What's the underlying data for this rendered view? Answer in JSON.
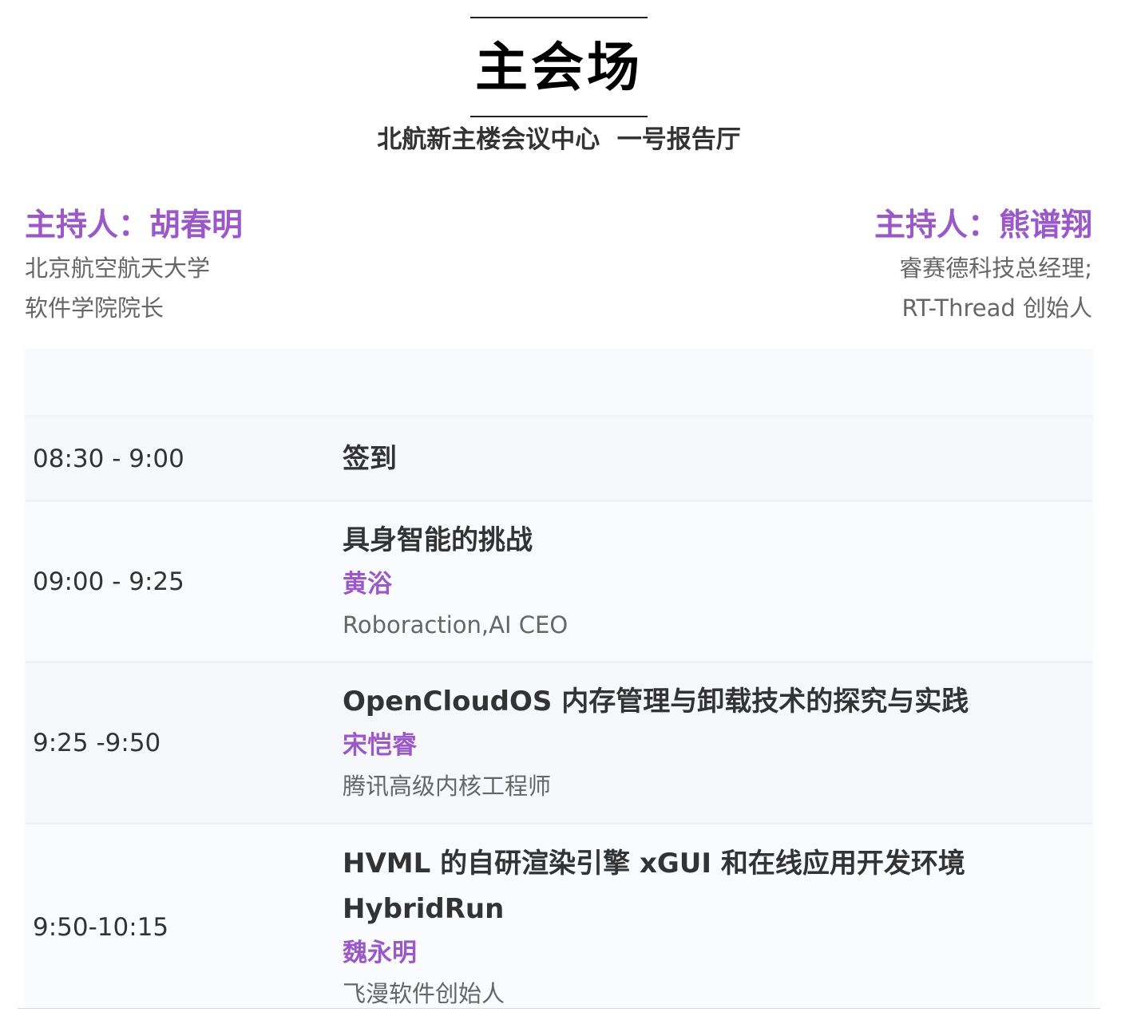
{
  "header": {
    "title": "主会场",
    "venue": "北航新主楼会议中心  一号报告厅"
  },
  "hosts": {
    "left": {
      "name": "主持人：胡春明",
      "lines": [
        "北京航空航天大学",
        "软件学院院长"
      ]
    },
    "right": {
      "name": "主持人：熊谱翔",
      "lines": [
        "睿赛德科技总经理;",
        "RT-Thread 创始人"
      ]
    }
  },
  "schedule": [
    {
      "time": "08:30 - 9:00",
      "title": "签到"
    },
    {
      "time": "09:00 - 9:25",
      "title": "具身智能的挑战",
      "speaker": "黄浴",
      "affiliation": "Roboraction,AI CEO"
    },
    {
      "time": "9:25 -9:50",
      "title": "OpenCloudOS 内存管理与卸载技术的探究与实践",
      "speaker": "宋恺睿",
      "affiliation": "腾讯高级内核工程师"
    },
    {
      "time": "9:50-10:15",
      "title": "HVML 的自研渲染引擎 xGUI 和在线应用开发环境 HybridRun",
      "speaker": "魏永明",
      "affiliation": "飞漫软件创始人"
    }
  ],
  "colors": {
    "accent": "#9b59c8",
    "text": "#333333",
    "muted": "#666666",
    "row_bg": "#f8f9fc"
  }
}
